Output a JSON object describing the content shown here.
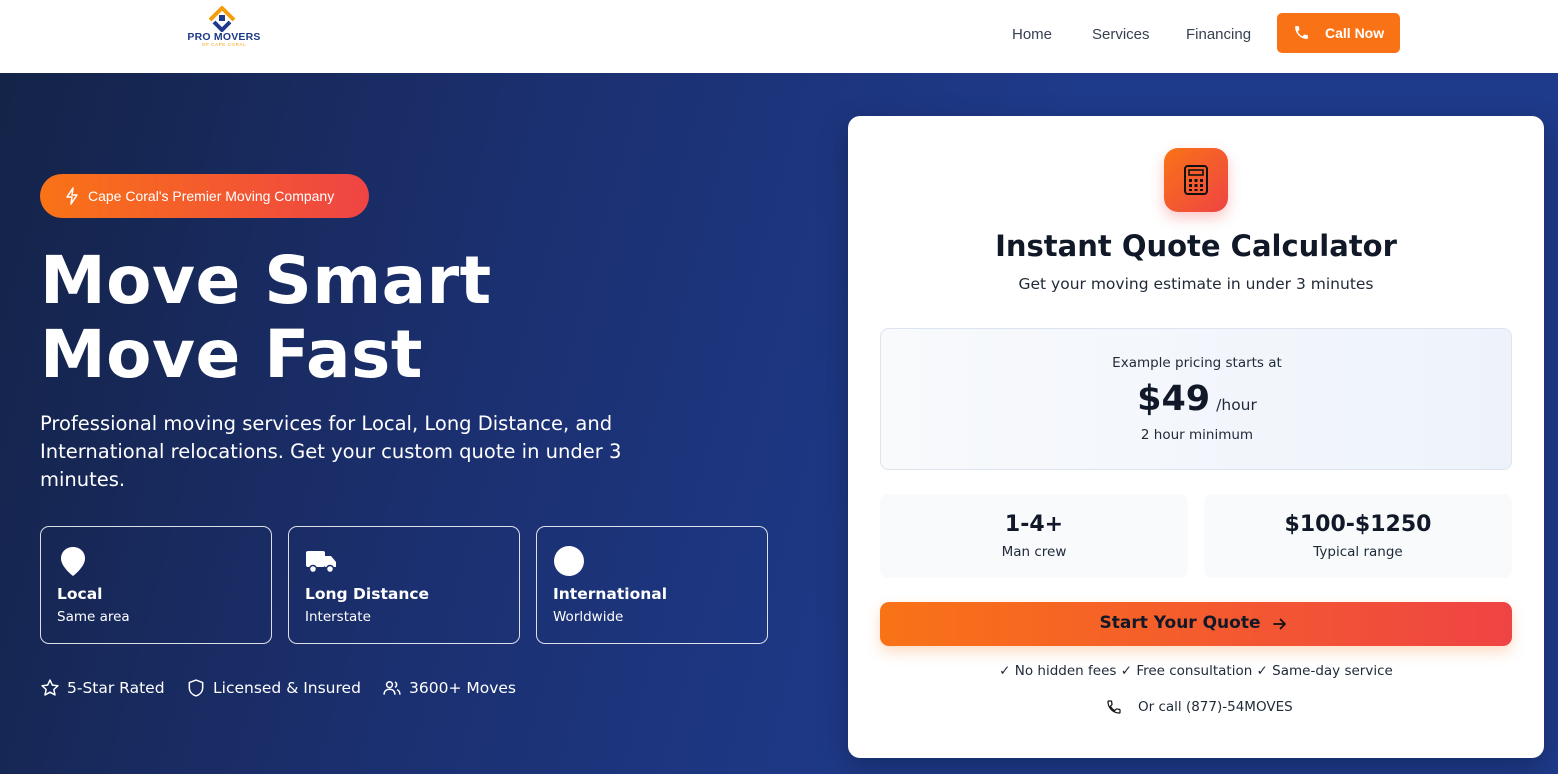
{
  "nav": {
    "logo_name": "PRO MOVERS",
    "logo_sub": "OF CAPE CORAL",
    "links": [
      "Home",
      "Services",
      "Financing"
    ],
    "call_label": "Call Now"
  },
  "hero": {
    "badge": "Cape Coral's Premier Moving Company",
    "headline_1": "Move Smart",
    "headline_2": "Move Fast",
    "description_lines": [
      "Professional moving services for Local, Long Distance, and",
      "International relocations. Get your custom quote in under 3",
      "minutes."
    ],
    "services": [
      {
        "title": "Local",
        "sub": "Same area",
        "icon": "map-pin-icon"
      },
      {
        "title": "Long Distance",
        "sub": "Interstate",
        "icon": "truck-icon"
      },
      {
        "title": "International",
        "sub": "Worldwide",
        "icon": "globe-icon"
      }
    ],
    "trust": [
      {
        "label": "5-Star Rated",
        "icon": "star-icon"
      },
      {
        "label": "Licensed & Insured",
        "icon": "shield-icon"
      },
      {
        "label": "3600+ Moves",
        "icon": "users-icon"
      }
    ]
  },
  "quote": {
    "icon": "calculator-icon",
    "title": "Instant Quote Calculator",
    "subtitle": "Get your moving estimate in under 3 minutes",
    "price_label": "Example pricing starts at",
    "price_amount": "$49",
    "price_unit": "/hour",
    "price_min": "2 hour minimum",
    "stats": [
      {
        "value": "1-4+",
        "label": "Man crew"
      },
      {
        "value": "$100-$1250",
        "label": "Typical range"
      }
    ],
    "start_label": "Start Your Quote",
    "perks": "✓ No hidden fees ✓ Free consultation ✓ Same-day service",
    "or_call": "Or call (877)-54MOVES"
  },
  "colors": {
    "accent": "#f97316",
    "accent_end": "#ef4444",
    "hero_dark": "#142348",
    "hero_blue": "#1e3a8a",
    "nav_bg": "#ffffff"
  }
}
